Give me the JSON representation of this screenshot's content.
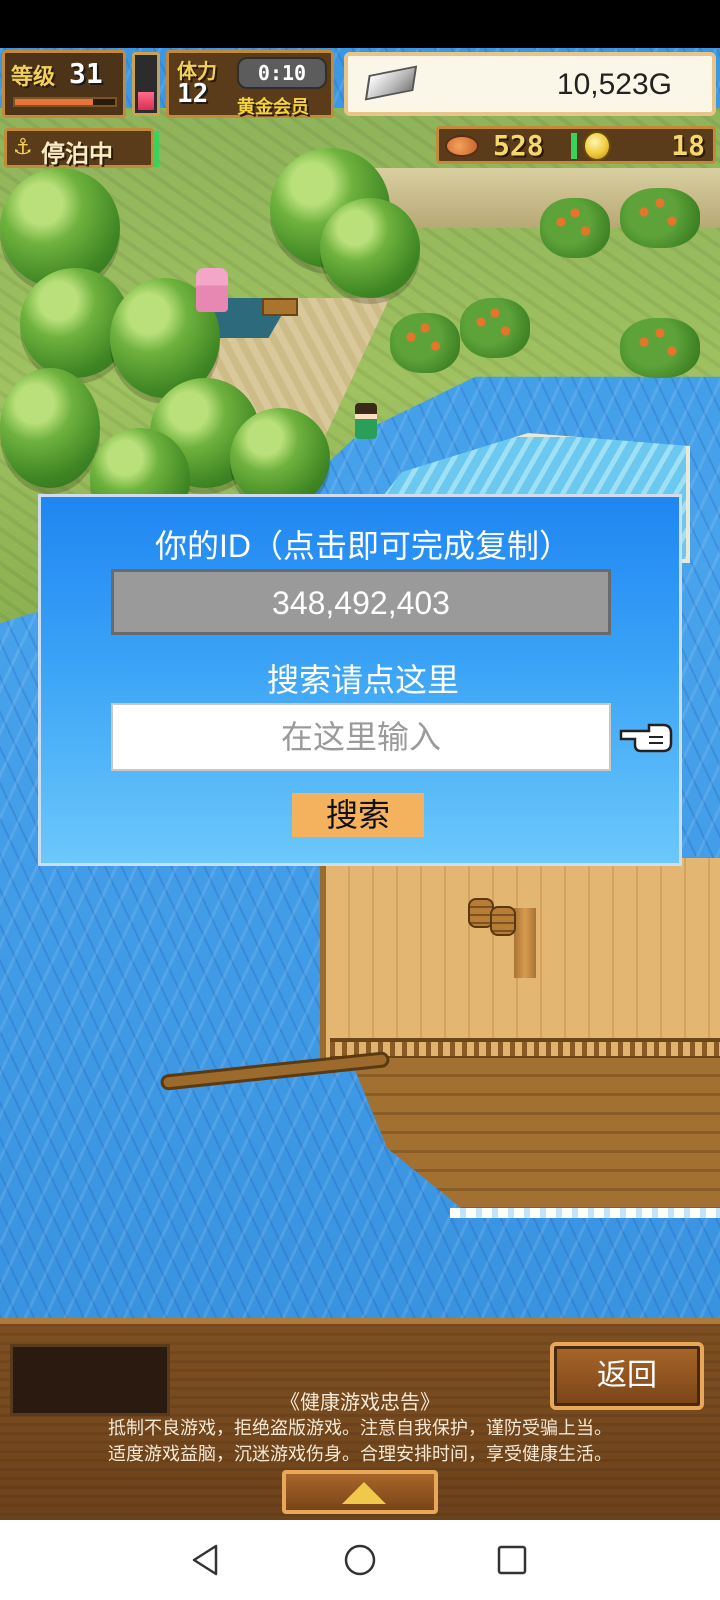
{
  "hud": {
    "level_label": "等级",
    "level_value": "31",
    "xp_fraction": 0.78,
    "stamina_fraction": 0.35,
    "stamina_label": "体力",
    "stamina_value": "12",
    "timer": "0:10",
    "gold_member_label": "黄金会员",
    "money": "10,523G",
    "status_label": "停泊中",
    "food": "528",
    "medals": "18"
  },
  "dialog": {
    "title": "你的ID（点击即可完成复制）",
    "user_id": "348,492,403",
    "search_hint": "搜索请点这里",
    "search_placeholder": "在这里输入",
    "search_button": "搜索"
  },
  "bottom": {
    "back_button": "返回",
    "notice_title": "《健康游戏忠告》",
    "notice_line1": "抵制不良游戏，拒绝盗版游戏。注意自我保护，谨防受骗上当。",
    "notice_line2": "适度游戏益脑，沉迷游戏伤身。合理安排时间，享受健康生活。"
  },
  "icons": {
    "silver": "silver-bar-icon",
    "anchor": "anchor-icon",
    "food": "food-icon",
    "medal": "medal-icon",
    "pointer": "pointer-hand-icon",
    "expand": "triangle-up-icon",
    "nav": [
      "back-icon",
      "home-icon",
      "recent-apps-icon"
    ]
  },
  "colors": {
    "dialog_top": "#1f86f2",
    "dialog_bottom": "#6cc8fb",
    "search_button": "#f4b25e",
    "id_box": "#9a9a9a"
  }
}
